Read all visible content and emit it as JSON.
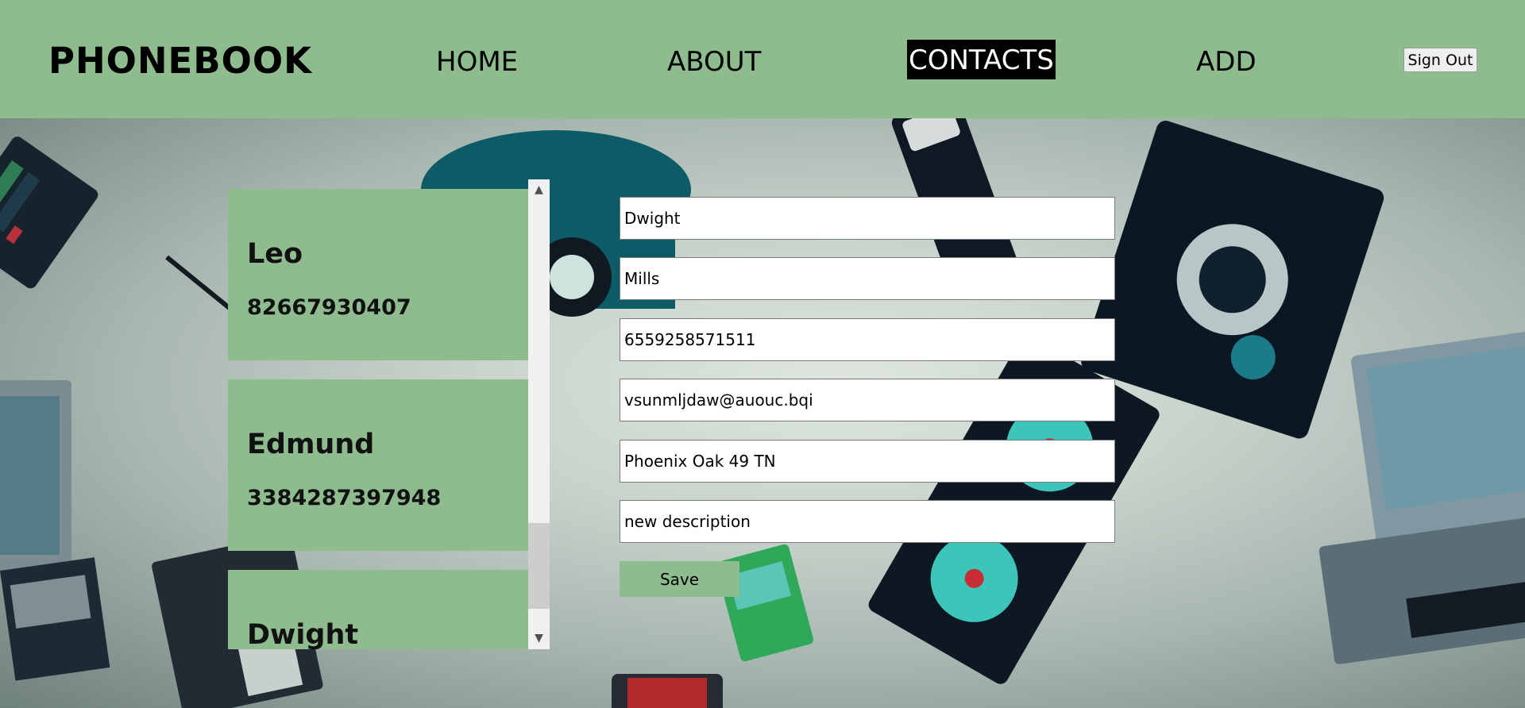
{
  "header": {
    "brand": "PHONEBOOK",
    "nav": {
      "home": "HOME",
      "about": "ABOUT",
      "contacts": "CONTACTS",
      "add": "ADD"
    },
    "sign_out_label": "Sign Out"
  },
  "contacts": [
    {
      "name": "Leo",
      "phone": "82667930407"
    },
    {
      "name": "Edmund",
      "phone": "3384287397948"
    },
    {
      "name": "Dwight",
      "phone": ""
    }
  ],
  "form": {
    "first_name": "Dwight",
    "last_name": "Mills",
    "phone": "6559258571511",
    "email": "vsunmljdaw@auouc.bqi",
    "address": "Phoenix Oak 49 TN",
    "description": "new description",
    "save_label": "Save"
  },
  "icons": {
    "scroll_up": "scroll-up-arrow-icon",
    "scroll_down": "scroll-down-arrow-icon"
  },
  "colors": {
    "accent": "#8fbc8f",
    "active_nav_bg": "#000000"
  }
}
